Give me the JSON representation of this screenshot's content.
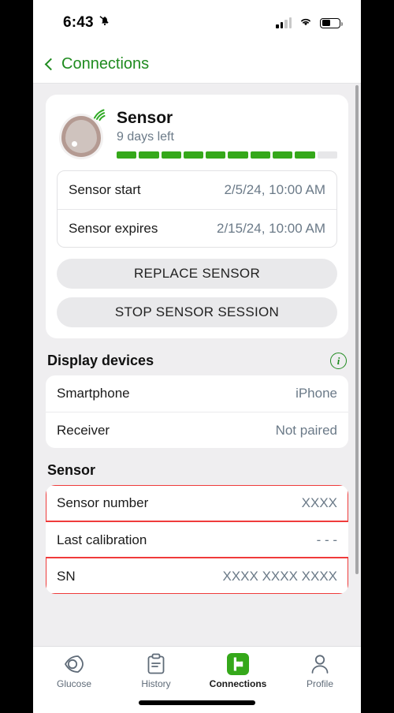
{
  "status_bar": {
    "time": "6:43",
    "mute_icon": "bell-slash-icon",
    "signal_icon": "cellular-signal-icon",
    "wifi_icon": "wifi-icon",
    "battery_icon": "battery-icon"
  },
  "nav": {
    "back_icon": "chevron-left-icon",
    "title": "Connections"
  },
  "sensor_card": {
    "image_name": "sensor-device-image",
    "signal_icon": "signal-waves-icon",
    "title": "Sensor",
    "subtitle": "9 days left",
    "progress_total": 10,
    "progress_filled": 9,
    "progress_color": "#35a81a",
    "progress_empty_color": "#e7e7e9",
    "rows": [
      {
        "label": "Sensor start",
        "value": "2/5/24, 10:00 AM"
      },
      {
        "label": "Sensor expires",
        "value": "2/15/24, 10:00 AM"
      }
    ],
    "buttons": [
      {
        "label": "REPLACE SENSOR"
      },
      {
        "label": "STOP SENSOR SESSION"
      }
    ]
  },
  "display_devices": {
    "title": "Display devices",
    "info_icon": "info-circle-icon",
    "rows": [
      {
        "label": "Smartphone",
        "value": "iPhone"
      },
      {
        "label": "Receiver",
        "value": "Not paired"
      }
    ]
  },
  "sensor_section": {
    "title": "Sensor",
    "highlight_color": "#ef3b3b",
    "rows": [
      {
        "label": "Sensor number",
        "value": "XXXX",
        "highlighted": true
      },
      {
        "label": "Last calibration",
        "value": "- - -",
        "highlighted": false
      },
      {
        "label": "SN",
        "value": "XXXX XXXX XXXX",
        "highlighted": true
      }
    ]
  },
  "tabbar": {
    "tabs": [
      {
        "label": "Glucose",
        "icon": "glucose-eye-icon",
        "active": false
      },
      {
        "label": "History",
        "icon": "clipboard-icon",
        "active": false
      },
      {
        "label": "Connections",
        "icon": "connections-icon",
        "active": true
      },
      {
        "label": "Profile",
        "icon": "person-icon",
        "active": false
      }
    ],
    "active_color": "#35a81a"
  }
}
